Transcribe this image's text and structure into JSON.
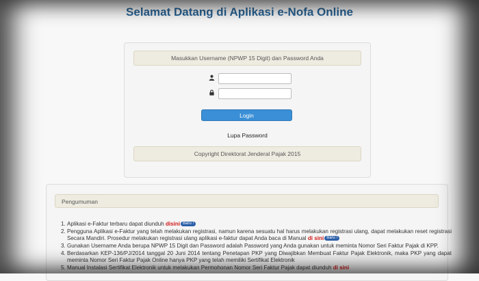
{
  "header": {
    "title": "Selamat Datang di Aplikasi e-Nofa Online"
  },
  "login": {
    "instruction": "Masukkan Username (NPWP 15 Digit) dan Password Anda",
    "username_value": "",
    "password_value": "",
    "username_icon": "user-icon",
    "password_icon": "lock-icon",
    "login_label": "Login",
    "forgot_label": "Lupa Password",
    "copyright": "Copyright Direktorat Jenderal Pajak 2015"
  },
  "announcement": {
    "heading": "Pengumuman",
    "badge": "Baru !",
    "items": [
      {
        "text": "Aplikasi e-Faktur terbaru dapat diunduh ",
        "link": "disini"
      },
      {
        "text": "Pengguna Aplikasi e-Faktur yang telah melakukan registrasi, namun karena sesuatu hal harus melakukan registrasi ulang, dapat melakukan reset registrasi Secara Mandiri. Prosedur melakukan registrasi ulang aplikasi e-faktur dapat Anda baca di Manual ",
        "link": "di sini"
      },
      {
        "text": "Gunakan Username Anda berupa NPWP 15 Digit dan Password adalah Password yang Anda gunakan untuk meminta Nomor Seri Faktur Pajak di KPP."
      },
      {
        "text": "Berdasarkan KEP-136/PJ/2014 tanggal 20 Juni 2014 tentang Penetapan PKP yang Diwajibkan Membuat Faktur Pajak Elektronik, maka PKP yang dapat meminta Nomor Seri Faktur Pajak Online hanya PKP yang telah memiliki Sertifikat Elektronik"
      },
      {
        "text": "Manual Instalasi Sertifikat Elektronik untuk melakukan Permohonan Nomor Seri Faktur Pajak dapat diunduh ",
        "link": "di sini"
      }
    ]
  },
  "colors": {
    "title": "#2a6496",
    "button": "#3a8fd6",
    "link_red": "#d01818",
    "badge": "#2b5fa8"
  }
}
